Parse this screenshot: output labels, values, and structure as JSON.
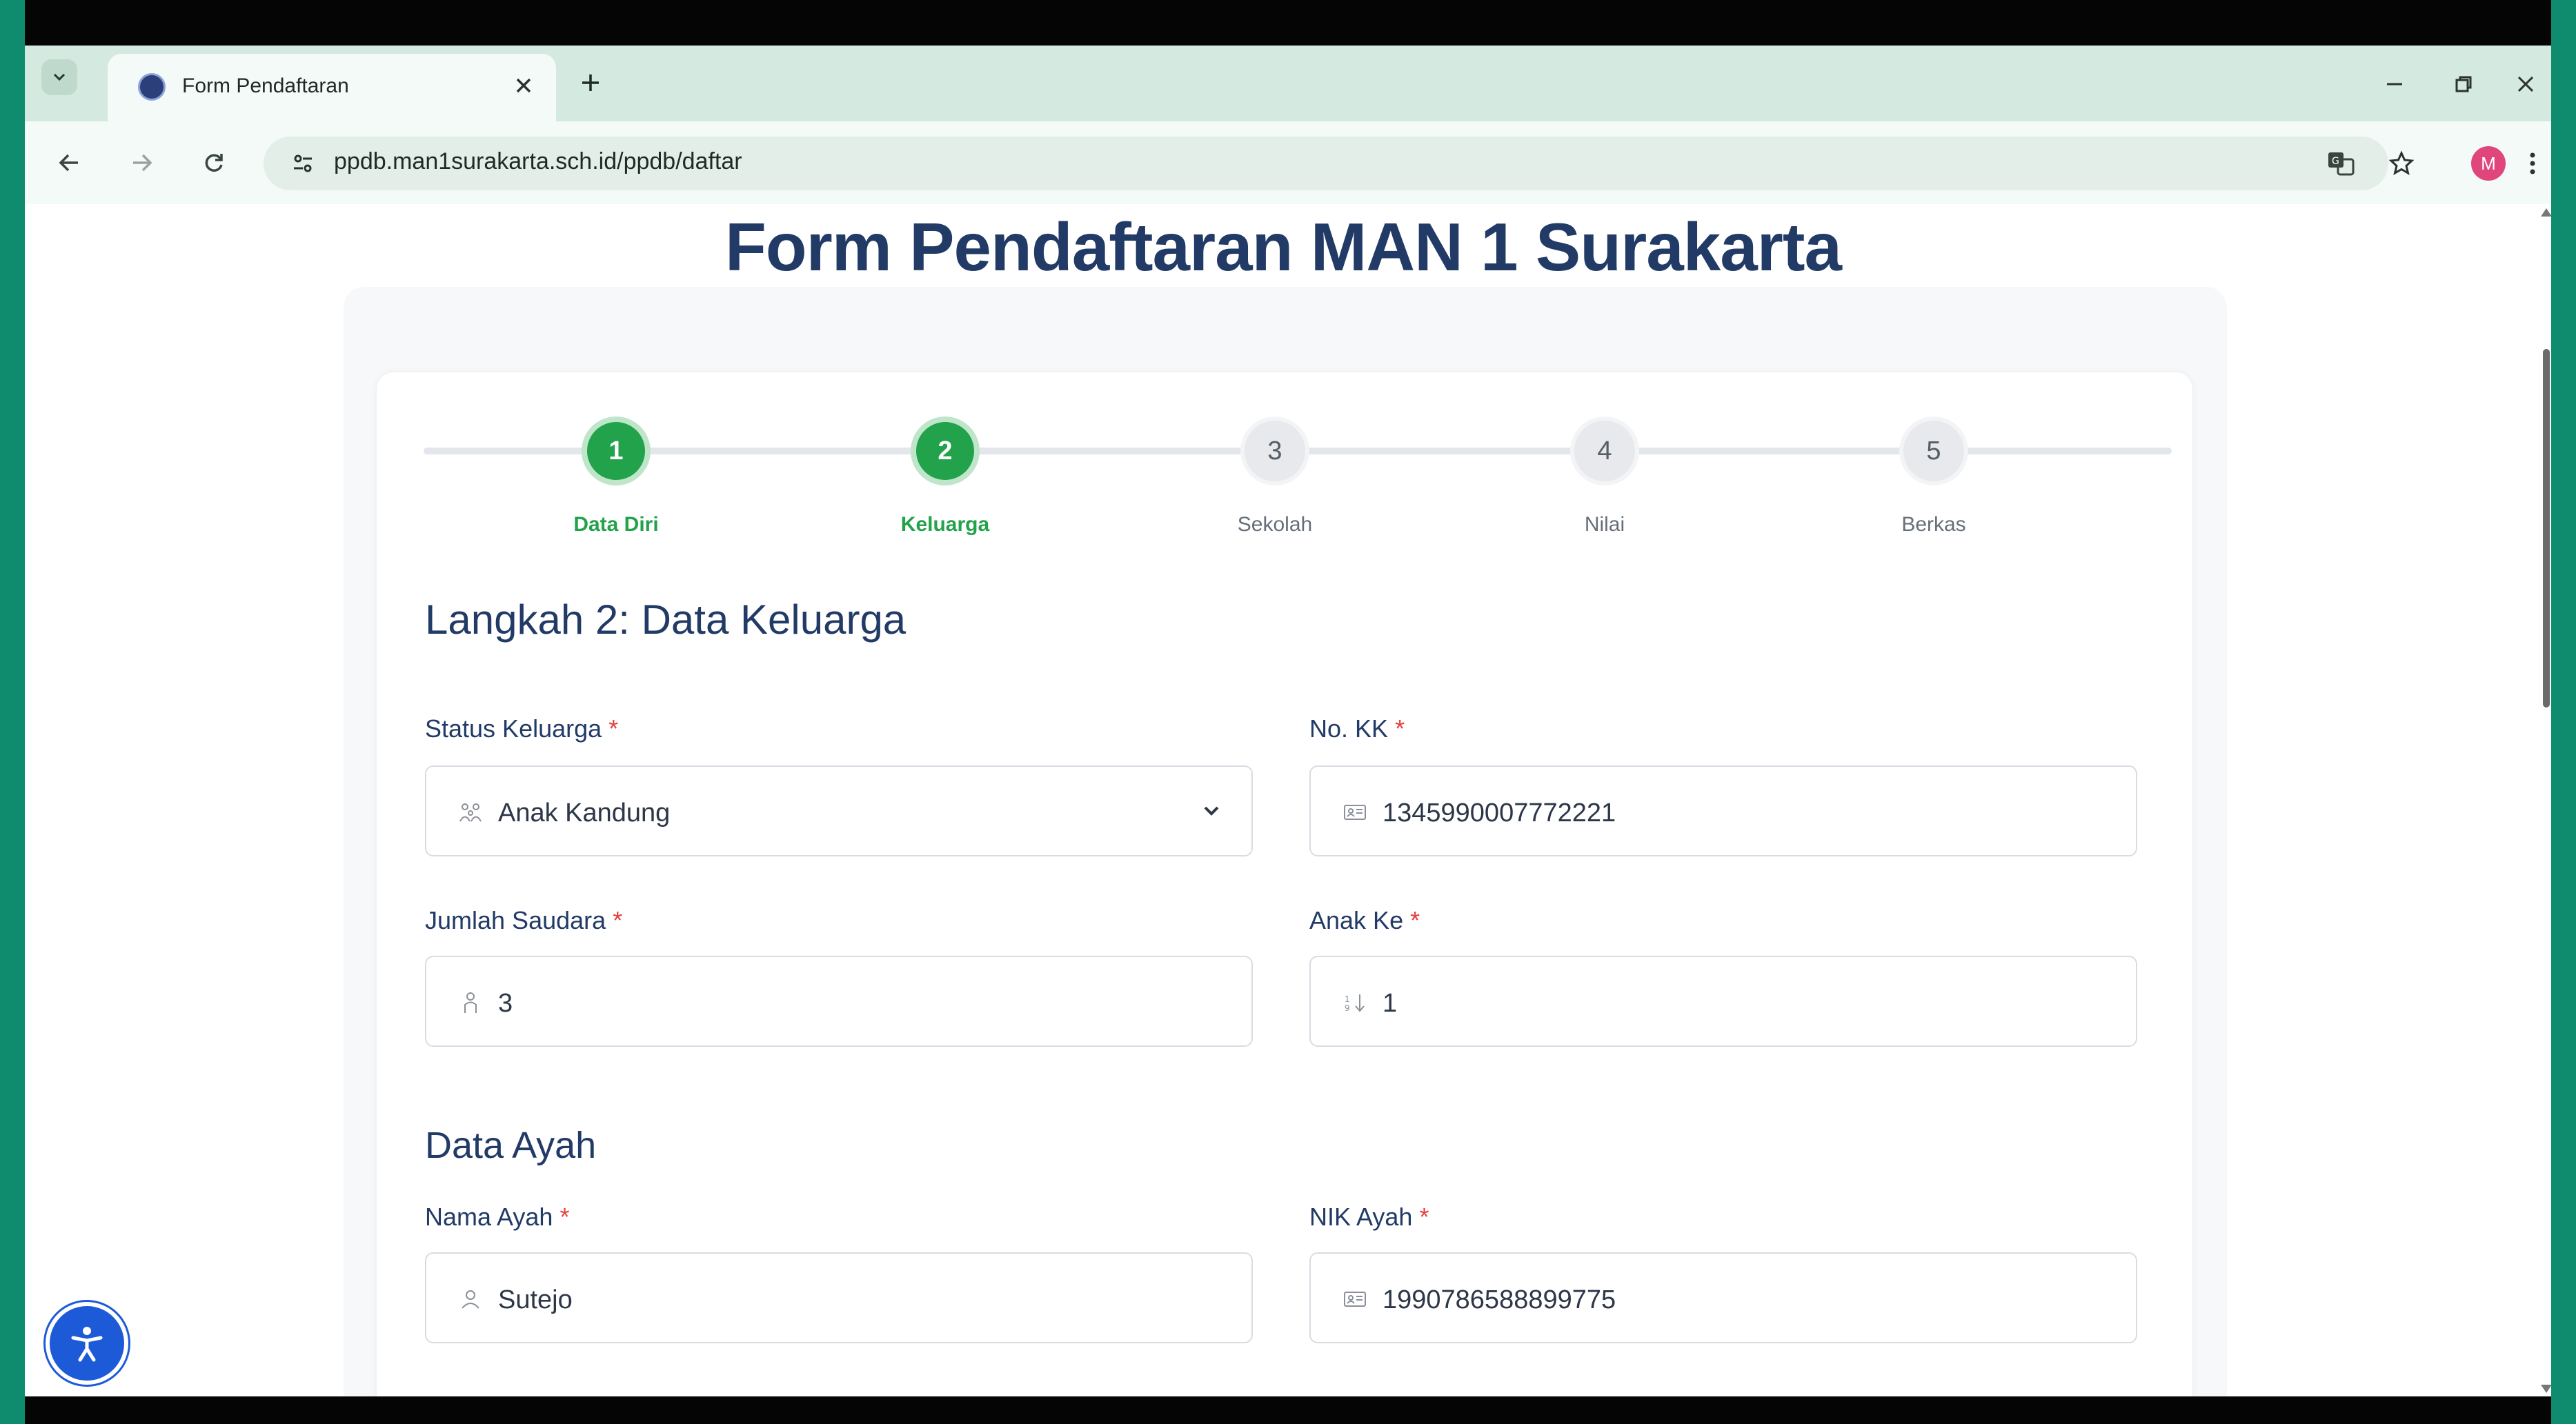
{
  "browser": {
    "tab_title": "Form Pendaftaran",
    "url": "ppdb.man1surakarta.sch.id/ppdb/daftar",
    "profile_initial": "M"
  },
  "page": {
    "title": "Form Pendaftaran MAN 1 Surakarta"
  },
  "stepper": {
    "steps": [
      {
        "number": "1",
        "label": "Data Diri",
        "status": "done"
      },
      {
        "number": "2",
        "label": "Keluarga",
        "status": "current"
      },
      {
        "number": "3",
        "label": "Sekolah",
        "status": "todo"
      },
      {
        "number": "4",
        "label": "Nilai",
        "status": "todo"
      },
      {
        "number": "5",
        "label": "Berkas",
        "status": "todo"
      }
    ]
  },
  "form": {
    "step_heading": "Langkah 2: Data Keluarga",
    "status_keluarga": {
      "label": "Status Keluarga",
      "required": "*",
      "value": "Anak Kandung",
      "icon": "family-icon"
    },
    "no_kk": {
      "label": "No. KK",
      "required": "*",
      "value": "1345990007772221",
      "icon": "id-card-icon"
    },
    "jumlah_saudara": {
      "label": "Jumlah Saudara",
      "required": "*",
      "value": "3",
      "icon": "people-icon"
    },
    "anak_ke": {
      "label": "Anak Ke",
      "required": "*",
      "value": "1",
      "icon": "sort-numeric-icon"
    },
    "ayah_heading": "Data Ayah",
    "nama_ayah": {
      "label": "Nama Ayah",
      "required": "*",
      "value": "Sutejo",
      "icon": "user-icon"
    },
    "nik_ayah": {
      "label": "NIK Ayah",
      "required": "*",
      "value": "1990786588899775",
      "icon": "id-card-icon"
    }
  },
  "colors": {
    "frame": "#0f8c6e",
    "title": "#223a66",
    "step_done": "#22a24a",
    "required": "#e53e3e",
    "accessibility": "#1d5ad8"
  }
}
